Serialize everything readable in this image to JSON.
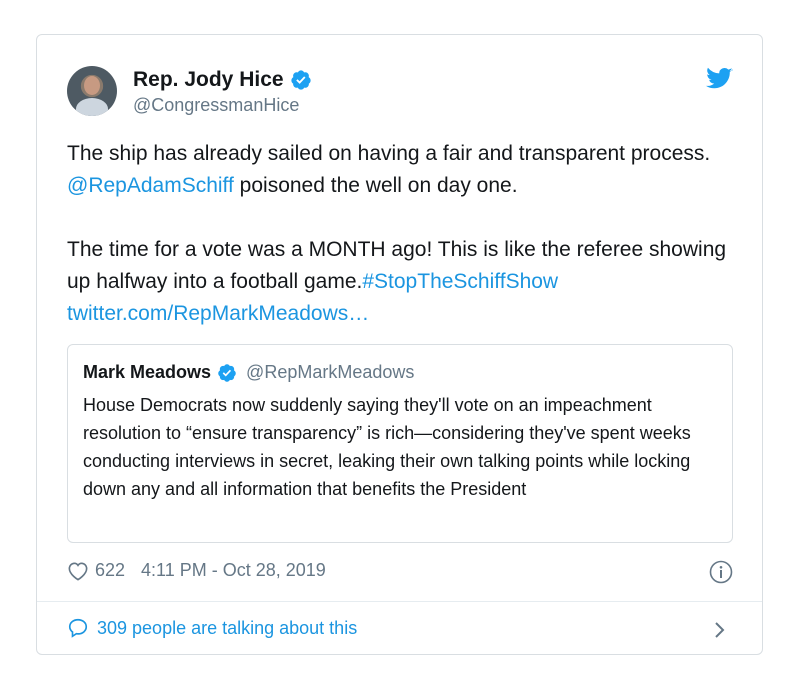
{
  "author": {
    "name": "Rep. Jody Hice",
    "handle": "@CongressmanHice"
  },
  "tweet": {
    "p1_a": "The ship has already sailed on having a fair and transparent process. ",
    "p1_mention": "@RepAdamSchiff",
    "p1_b": " poisoned the well on day one.",
    "p2_a": "The time for a vote was a MONTH ago! This is like the referee showing up halfway into a football game.",
    "p2_hashtag": "#StopTheSchiffShow",
    "p2_link": "twitter.com/RepMarkMeadows…"
  },
  "quote": {
    "name": "Mark Meadows",
    "handle": "@RepMarkMeadows",
    "text": "House Democrats now suddenly saying they'll vote on an impeachment resolution to “ensure transparency” is rich—considering they've spent weeks conducting interviews in secret, leaking their own talking points while locking down any and all information that benefits the President"
  },
  "meta": {
    "likes": "622",
    "timestamp": "4:11 PM - Oct 28, 2019"
  },
  "footer": {
    "conversation": "309 people are talking about this"
  },
  "icons": {
    "verified": "verified-badge-icon",
    "twitter": "twitter-bird-icon",
    "like": "heart-icon",
    "info": "info-icon",
    "reply": "speech-bubble-icon",
    "chevron": "chevron-right-icon"
  },
  "colors": {
    "accent": "#1b95e0",
    "text": "#14171a",
    "secondary": "#657786",
    "border": "#d9dee2"
  }
}
